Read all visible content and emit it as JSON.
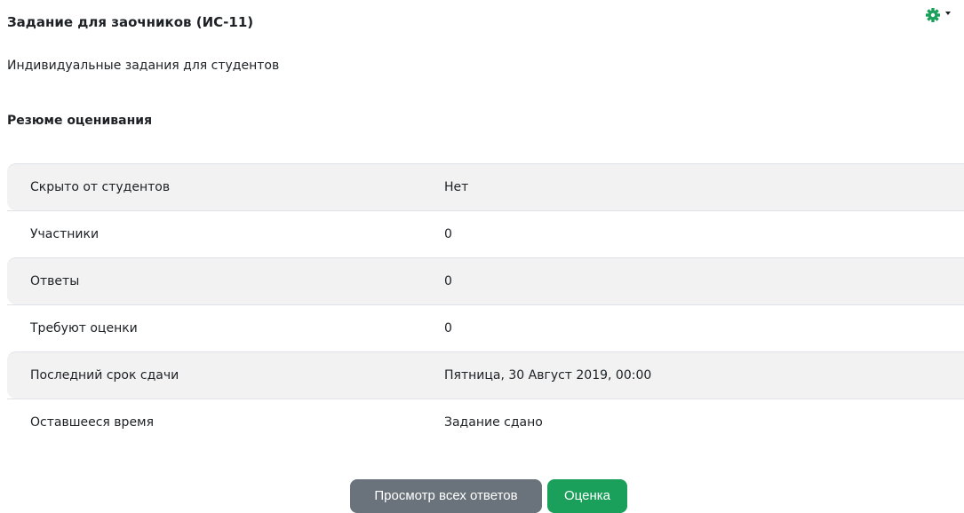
{
  "header": {
    "title": "Задание для заочников (ИС-11)",
    "settings_icon": "gear-icon",
    "accent_color": "#1aa05a"
  },
  "intro": {
    "text": "Индивидуальные задания для студентов"
  },
  "summary": {
    "heading": "Резюме оценивания",
    "rows": [
      {
        "label": "Скрыто от студентов",
        "value": "Нет"
      },
      {
        "label": "Участники",
        "value": "0"
      },
      {
        "label": "Ответы",
        "value": "0"
      },
      {
        "label": "Требуют оценки",
        "value": "0"
      },
      {
        "label": "Последний срок сдачи",
        "value": "Пятница, 30 Август 2019, 00:00"
      },
      {
        "label": "Оставшееся время",
        "value": "Задание сдано"
      }
    ]
  },
  "actions": {
    "view_all_label": "Просмотр всех ответов",
    "grade_label": "Оценка",
    "view_all_color": "#6a737b",
    "grade_color": "#1aa05a"
  }
}
